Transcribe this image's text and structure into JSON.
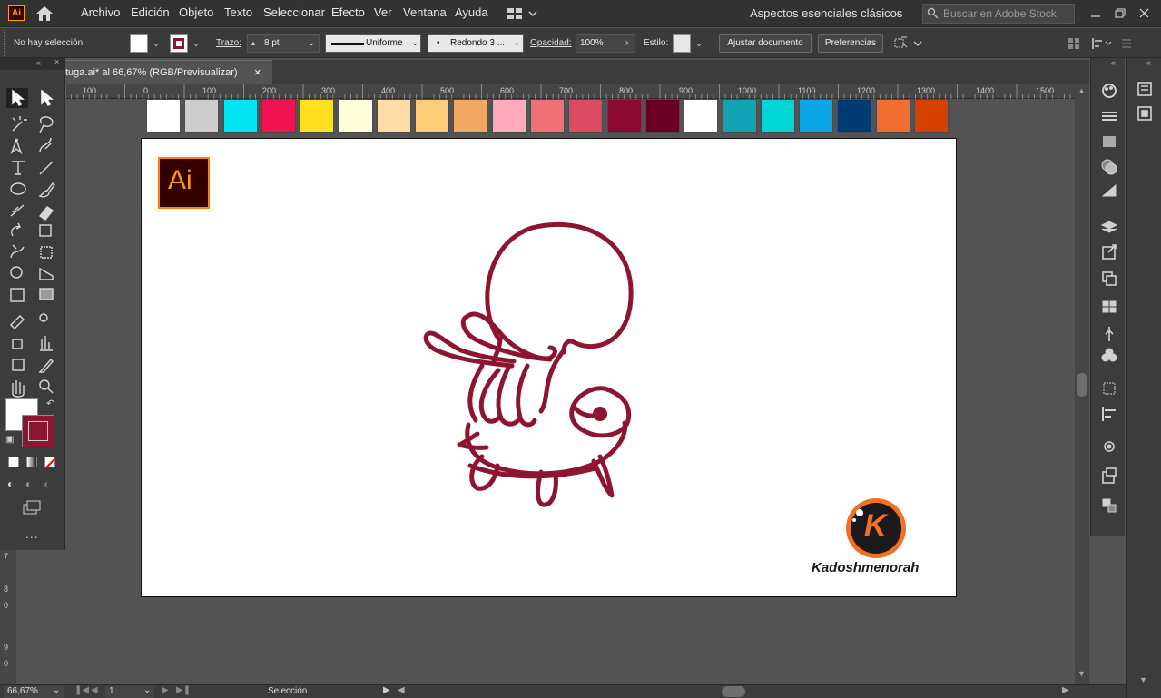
{
  "app": {
    "logo_text": "Ai",
    "menu": [
      "Archivo",
      "Edición",
      "Objeto",
      "Texto",
      "Seleccionar",
      "Efecto",
      "Ver",
      "Ventana",
      "Ayuda"
    ],
    "workspace": "Aspectos esenciales clásicos",
    "stock_search_placeholder": "Buscar en Adobe Stock"
  },
  "control_bar": {
    "selection_status": "No hay selección",
    "stroke_label": "Trazo:",
    "stroke_weight": "8 pt",
    "stroke_profile": "Uniforme",
    "brush": "Redondo 3 ...",
    "opacity_label": "Opacidad:",
    "opacity_value": "100%",
    "style_label": "Estilo:",
    "adjust_document_button": "Ajustar documento",
    "preferences_button": "Preferencias"
  },
  "document": {
    "tab_title": "tuga.ai* al 66,67% (RGB/Previsualizar)",
    "close_glyph": "×"
  },
  "ruler_top": [
    "100",
    "0",
    "100",
    "200",
    "300",
    "400",
    "500",
    "600",
    "700",
    "800",
    "900",
    "1000",
    "1100",
    "1200",
    "1300",
    "1400",
    "1500"
  ],
  "ruler_left": [
    "7",
    "8",
    "0",
    "9",
    "0"
  ],
  "swatches": [
    "#ffffff",
    "#cccccc",
    "#00e6f0",
    "#f01455",
    "#ffe01e",
    "#fffcd9",
    "#ffdba6",
    "#ffcc78",
    "#f0a863",
    "#ffaabb",
    "#f07078",
    "#dc4b64",
    "#8c0a32",
    "#690023",
    "#ffffff",
    "#11a3b4",
    "#00d6d6",
    "#0aa6e6",
    "#003c73",
    "#f06e32",
    "#d74100"
  ],
  "artwork": {
    "stroke_color": "#8e1530",
    "ai_badge_text": "Ai",
    "brand_letter": "K",
    "brand_name": "Kadoshmenorah"
  },
  "colors": {
    "fill": "#ffffff",
    "stroke": "#8e1530",
    "ai_orange": "#ff9a00",
    "brand_orange": "#f37021"
  },
  "status_bar": {
    "zoom": "66,67%",
    "artboard_number": "1",
    "tool_name": "Selección"
  },
  "tools_more": "..."
}
